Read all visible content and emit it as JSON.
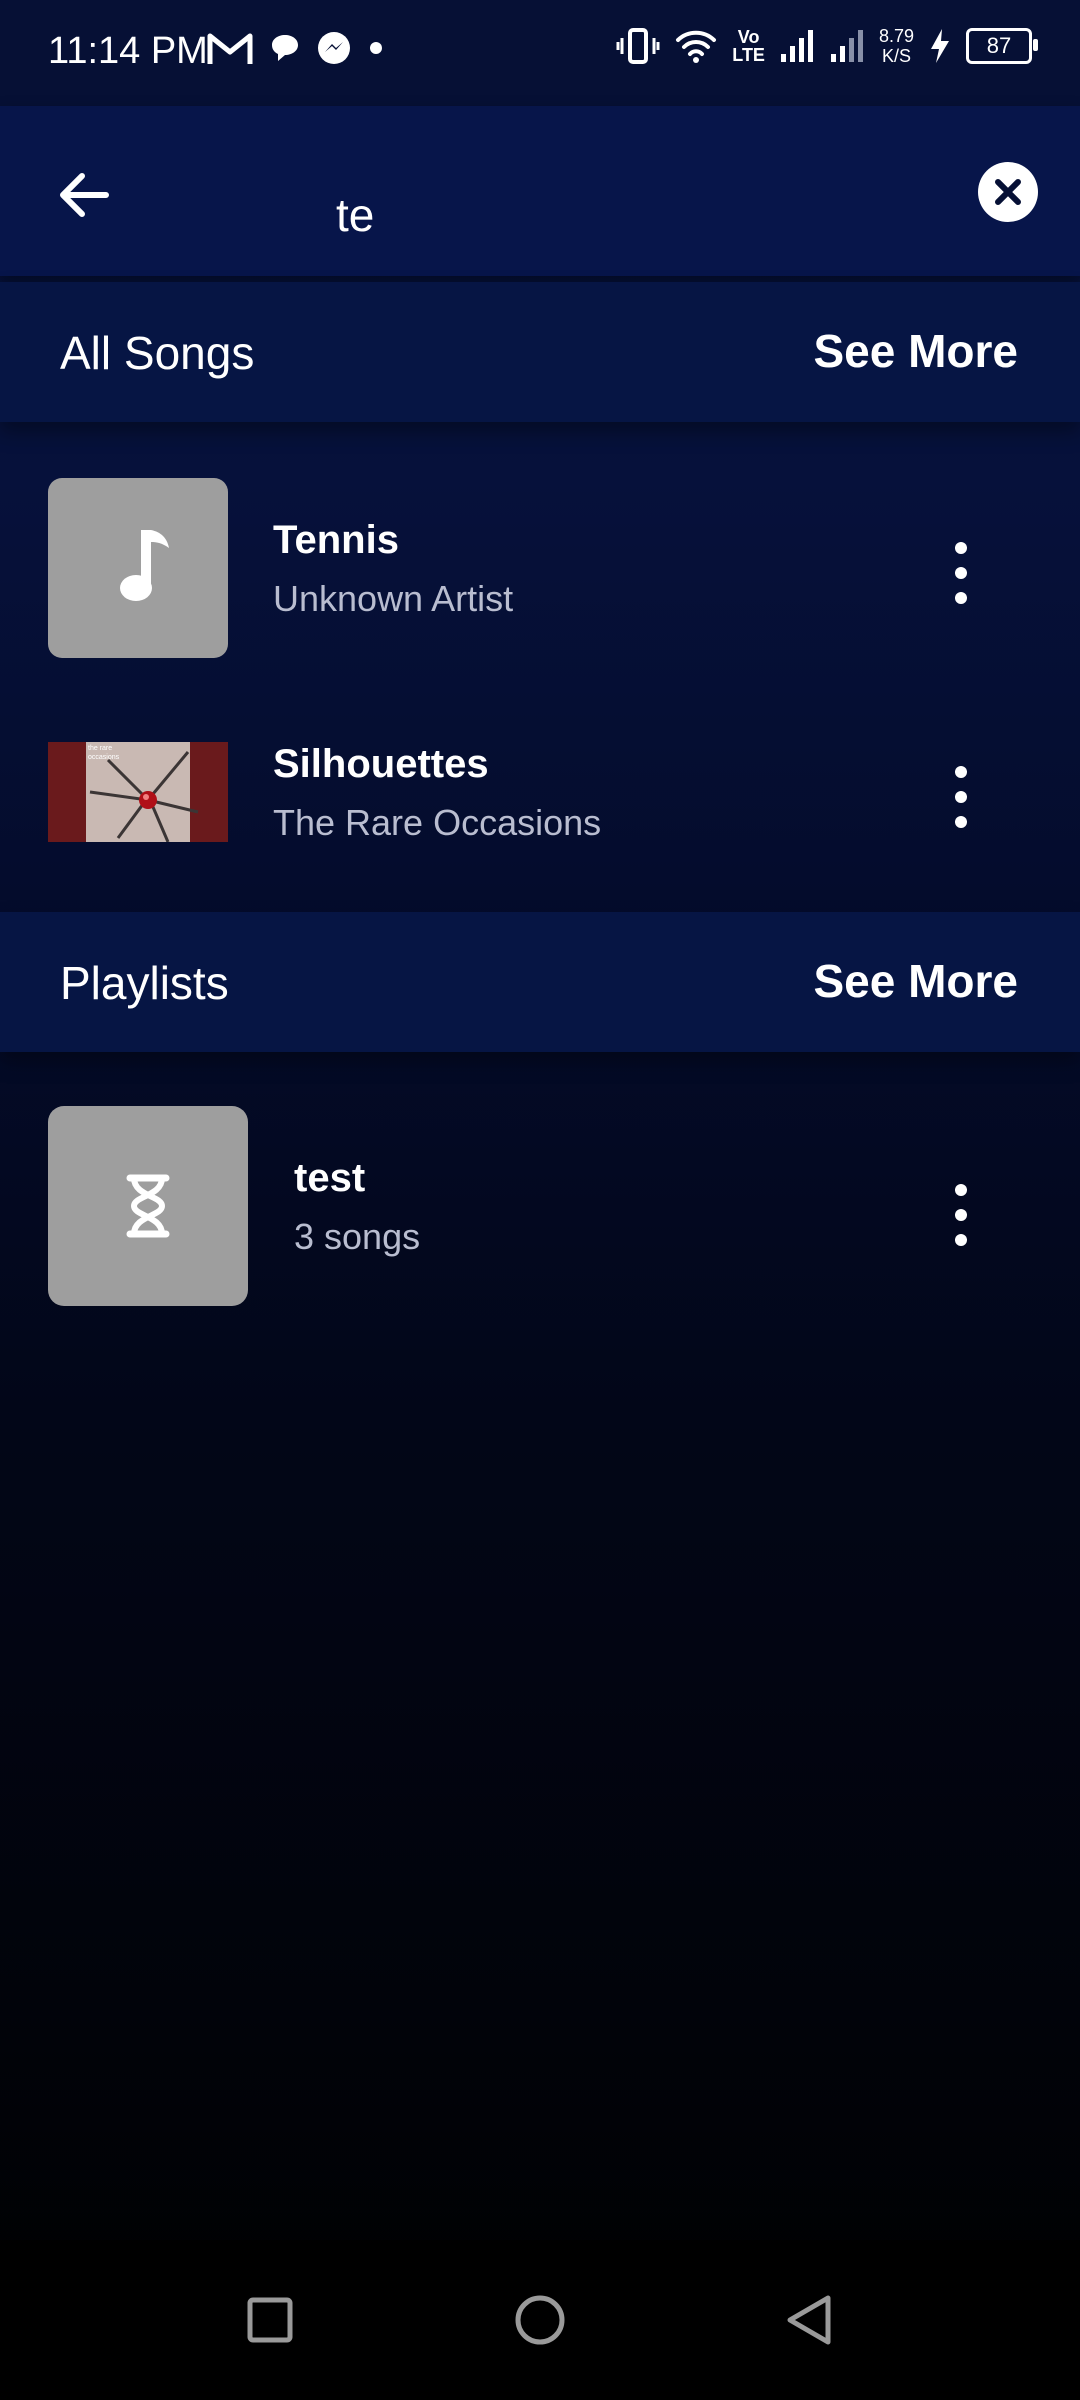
{
  "status_bar": {
    "time": "11:14 PM",
    "volte_top": "Vo",
    "volte_bottom": "LTE",
    "speed_value": "8.79",
    "speed_unit": "K/S",
    "battery": "87"
  },
  "search": {
    "query": "te"
  },
  "songs_section": {
    "title": "All Songs",
    "see_more": "See More",
    "items": [
      {
        "title": "Tennis",
        "artist": "Unknown Artist"
      },
      {
        "title": "Silhouettes",
        "artist": "The Rare Occasions",
        "album_art_text": "the rare occasions"
      }
    ]
  },
  "playlists_section": {
    "title": "Playlists",
    "see_more": "See More",
    "items": [
      {
        "title": "test",
        "subtitle": "3 songs"
      }
    ]
  },
  "colors": {
    "header_bg": "#07154a",
    "section_bg": "#061544",
    "thumb_gray": "#9e9e9e",
    "subtext": "#b9bdd0"
  }
}
